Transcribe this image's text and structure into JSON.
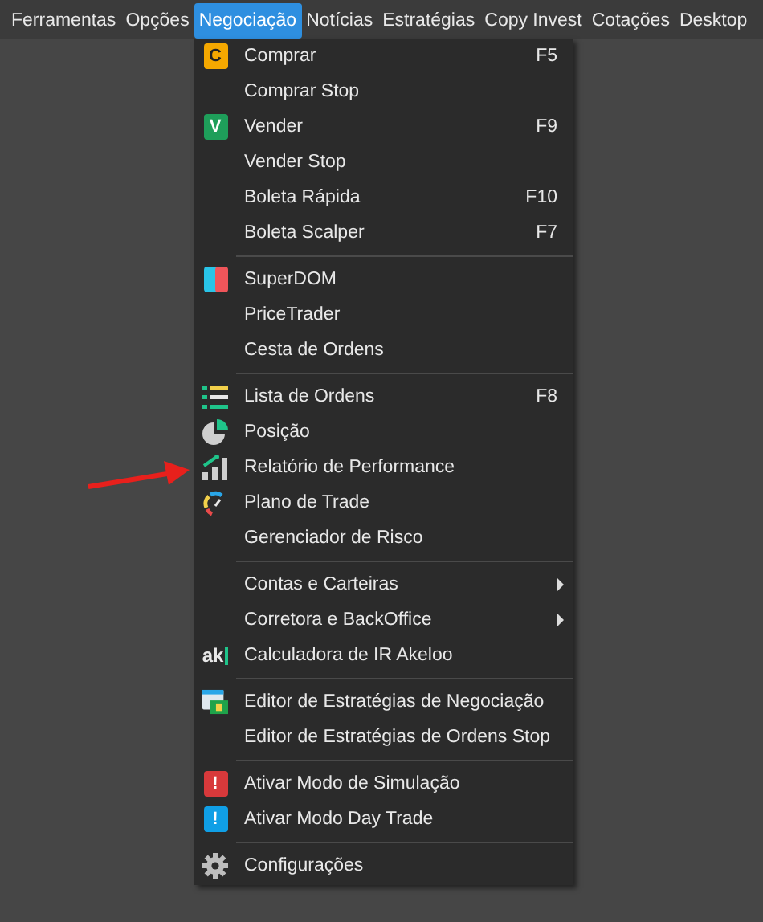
{
  "menu_bar": [
    {
      "label": "Ferramentas",
      "selected": false
    },
    {
      "label": "Opções",
      "selected": false
    },
    {
      "label": "Negociação",
      "selected": true
    },
    {
      "label": "Notícias",
      "selected": false
    },
    {
      "label": "Estratégias",
      "selected": false
    },
    {
      "label": "Copy Invest",
      "selected": false
    },
    {
      "label": "Cotações",
      "selected": false
    },
    {
      "label": "Desktop",
      "selected": false
    }
  ],
  "dropdown": [
    {
      "kind": "badge",
      "label": "Comprar",
      "shortcut": "F5",
      "badge": "C",
      "color": "#f5a800"
    },
    {
      "kind": "plain",
      "label": "Comprar Stop"
    },
    {
      "kind": "badge",
      "label": "Vender",
      "shortcut": "F9",
      "badge": "V",
      "color": "#1e9e5a"
    },
    {
      "kind": "plain",
      "label": "Vender Stop"
    },
    {
      "kind": "plain",
      "label": "Boleta Rápida",
      "shortcut": "F10"
    },
    {
      "kind": "plain",
      "label": "Boleta Scalper",
      "shortcut": "F7"
    },
    {
      "kind": "separator"
    },
    {
      "kind": "split",
      "label": "SuperDOM"
    },
    {
      "kind": "plain",
      "label": "PriceTrader"
    },
    {
      "kind": "plain",
      "label": "Cesta de Ordens"
    },
    {
      "kind": "separator"
    },
    {
      "kind": "list",
      "label": "Lista de Ordens",
      "shortcut": "F8"
    },
    {
      "kind": "pie",
      "label": "Posição"
    },
    {
      "kind": "bars",
      "label": "Relatório de Performance"
    },
    {
      "kind": "gauge",
      "label": "Plano de Trade"
    },
    {
      "kind": "plain",
      "label": "Gerenciador de Risco"
    },
    {
      "kind": "separator"
    },
    {
      "kind": "submenu",
      "label": "Contas e Carteiras"
    },
    {
      "kind": "submenu",
      "label": "Corretora e BackOffice"
    },
    {
      "kind": "logo",
      "label": "Calculadora de IR Akeloo",
      "badge": "ak"
    },
    {
      "kind": "separator"
    },
    {
      "kind": "window",
      "label": "Editor de Estratégias de Negociação"
    },
    {
      "kind": "plain",
      "label": "Editor de Estratégias de Ordens Stop"
    },
    {
      "kind": "separator"
    },
    {
      "kind": "badge",
      "label": "Ativar Modo de Simulação",
      "badge": "!",
      "color": "#d8393b"
    },
    {
      "kind": "badge",
      "label": "Ativar Modo Day Trade",
      "badge": "!",
      "color": "#109fe6"
    },
    {
      "kind": "separator"
    },
    {
      "kind": "gear",
      "label": "Configurações"
    }
  ]
}
